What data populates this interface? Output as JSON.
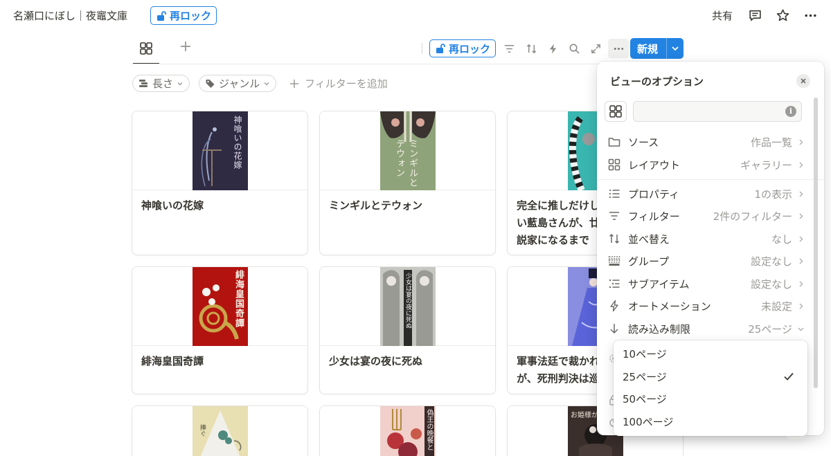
{
  "topbar": {
    "breadcrumb": "名瀬口にぼし｜夜竈文庫",
    "lock_label": "再ロック",
    "share_label": "共有",
    "comment_icon": "comment-icon",
    "star_icon": "star-icon",
    "more_icon": "more-icon"
  },
  "toolbar": {
    "view_icon": "gallery-icon",
    "add_view_glyph": "+",
    "lock_label": "再ロック",
    "icons": [
      "filter-icon",
      "sort-icon",
      "lightning-icon",
      "search-icon",
      "expand-icon",
      "more-icon"
    ],
    "new_label": "新規"
  },
  "filters": {
    "chips": [
      {
        "label": "長さ",
        "icon": "list-icon"
      },
      {
        "label": "ジャンル",
        "icon": "tag-icon"
      }
    ],
    "add_filter_label": "フィルターを追加"
  },
  "gallery": {
    "cards": [
      {
        "title": "神喰いの花嫁",
        "cover_text": "神喰いの花嫁",
        "cover_color": "#2f2b43"
      },
      {
        "title": "ミンギルとテウォン",
        "cover_text": "ミンギルとテウォン",
        "cover_color": "#8fa37a"
      },
      {
        "title": "完全に推しだけし\nい藍島さんが、廿\n説家になるまで",
        "cover_text": "",
        "cover_color": "#3ab6b0"
      },
      {
        "title": "緋海皇国奇譚",
        "cover_text": "緋海皇国奇譚",
        "cover_color": "#b3130f"
      },
      {
        "title": "少女は宴の夜に死ぬ",
        "cover_text": "少女は宴の夜に死ぬ",
        "cover_color": "#c7c7c2"
      },
      {
        "title": "軍事法廷で裁かれ\nが、死刑判決は巡",
        "cover_text": "",
        "cover_color": "#8a8ee0"
      },
      {
        "title": "",
        "cover_text": "捧ぐ",
        "cover_color": "#e8dfb2"
      },
      {
        "title": "",
        "cover_text": "偽王の晩餐と",
        "cover_color": "#f1cfca"
      },
      {
        "title": "",
        "cover_text": "お姫様が",
        "cover_color": "#3b2f2c"
      }
    ]
  },
  "view_options": {
    "title": "ビューのオプション",
    "name_input_value": "",
    "rows": [
      {
        "icon": "folder-icon",
        "label": "ソース",
        "value": "作品一覧"
      },
      {
        "icon": "gallery-icon",
        "label": "レイアウト",
        "value": "ギャラリー"
      },
      {
        "icon": "properties-icon",
        "label": "プロパティ",
        "value": "1の表示"
      },
      {
        "icon": "filter-icon",
        "label": "フィルター",
        "value": "2件のフィルター"
      },
      {
        "icon": "sort-icon",
        "label": "並べ替え",
        "value": "なし"
      },
      {
        "icon": "group-icon",
        "label": "グループ",
        "value": "設定なし"
      },
      {
        "icon": "subitem-icon",
        "label": "サブアイテム",
        "value": "設定なし"
      },
      {
        "icon": "lightning-icon",
        "label": "オートメーション",
        "value": "未設定"
      },
      {
        "icon": "arrow-down-icon",
        "label": "読み込み制限",
        "value": "25ページ"
      }
    ]
  },
  "load_limit_dropdown": {
    "options": [
      "10ページ",
      "25ページ",
      "50ページ",
      "100ページ"
    ],
    "selected": "25ページ"
  },
  "colors": {
    "accent": "#2383e2"
  }
}
